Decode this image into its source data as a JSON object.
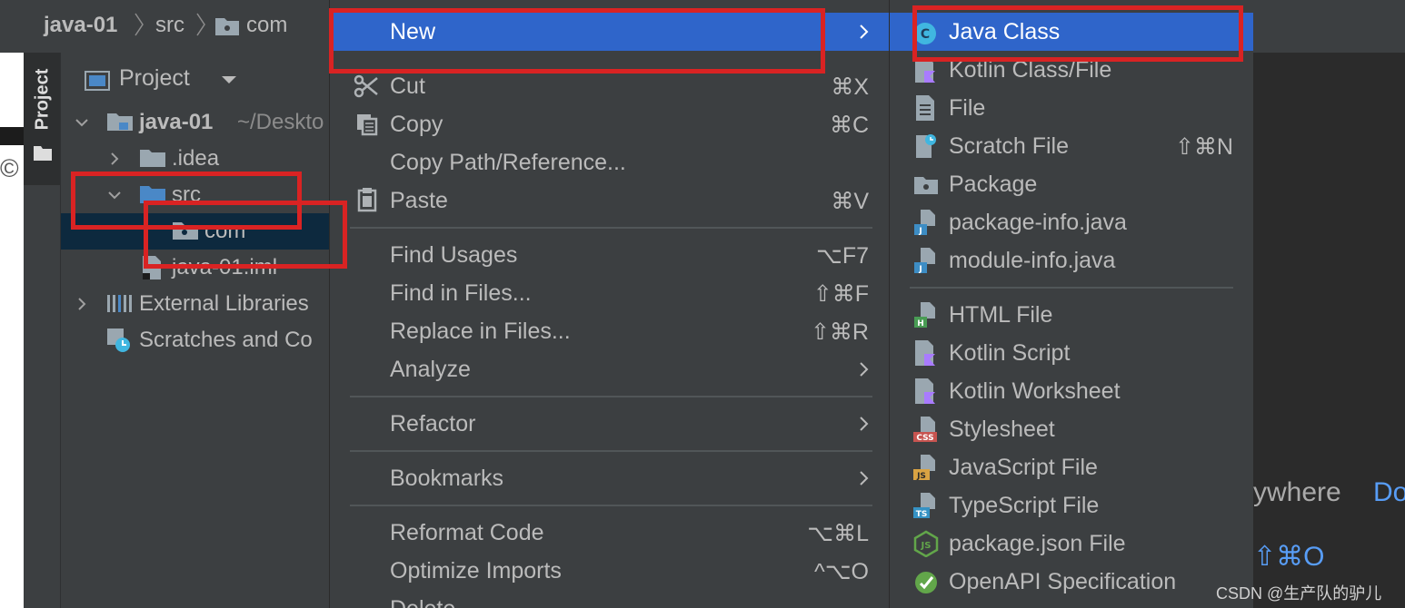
{
  "breadcrumb": {
    "project": "java-01",
    "src": "src",
    "com": "com"
  },
  "toolwindow": {
    "tab_label": "Project"
  },
  "project_panel": {
    "header": "Project",
    "tree": [
      {
        "label": "java-01",
        "hint": "~/Deskto"
      },
      {
        "label": ".idea"
      },
      {
        "label": "src"
      },
      {
        "label": "com"
      },
      {
        "label": "java-01.iml"
      },
      {
        "label": "External Libraries"
      },
      {
        "label": "Scratches and Co"
      }
    ]
  },
  "context_menu": {
    "items": [
      {
        "label": "New",
        "shortcut": ""
      },
      {
        "label": "Cut",
        "shortcut": "⌘X"
      },
      {
        "label": "Copy",
        "shortcut": "⌘C"
      },
      {
        "label": "Copy Path/Reference...",
        "shortcut": ""
      },
      {
        "label": "Paste",
        "shortcut": "⌘V"
      },
      {
        "label": "Find Usages",
        "shortcut": "⌥F7"
      },
      {
        "label": "Find in Files...",
        "shortcut": "⇧⌘F"
      },
      {
        "label": "Replace in Files...",
        "shortcut": "⇧⌘R"
      },
      {
        "label": "Analyze",
        "shortcut": ""
      },
      {
        "label": "Refactor",
        "shortcut": ""
      },
      {
        "label": "Bookmarks",
        "shortcut": ""
      },
      {
        "label": "Reformat Code",
        "shortcut": "⌥⌘L"
      },
      {
        "label": "Optimize Imports",
        "shortcut": "^⌥O"
      },
      {
        "label": "Delete",
        "shortcut": ""
      }
    ]
  },
  "new_submenu": {
    "items": [
      {
        "label": "Java Class",
        "shortcut": "",
        "badge": "C"
      },
      {
        "label": "Kotlin Class/File",
        "shortcut": "",
        "badge": "K"
      },
      {
        "label": "File",
        "shortcut": "",
        "badge": ""
      },
      {
        "label": "Scratch File",
        "shortcut": "⇧⌘N",
        "badge": ""
      },
      {
        "label": "Package",
        "shortcut": "",
        "badge": ""
      },
      {
        "label": "package-info.java",
        "shortcut": "",
        "badge": "J"
      },
      {
        "label": "module-info.java",
        "shortcut": "",
        "badge": "J"
      },
      {
        "label": "HTML File",
        "shortcut": "",
        "badge": "H"
      },
      {
        "label": "Kotlin Script",
        "shortcut": "",
        "badge": "K"
      },
      {
        "label": "Kotlin Worksheet",
        "shortcut": "",
        "badge": "K"
      },
      {
        "label": "Stylesheet",
        "shortcut": "",
        "badge": "CSS"
      },
      {
        "label": "JavaScript File",
        "shortcut": "",
        "badge": "JS"
      },
      {
        "label": "TypeScript File",
        "shortcut": "",
        "badge": "TS"
      },
      {
        "label": "package.json File",
        "shortcut": "",
        "badge": "JS"
      },
      {
        "label": "OpenAPI Specification",
        "shortcut": "",
        "badge": ""
      }
    ]
  },
  "editor_hint": {
    "text1": "ywhere",
    "text2": "Do",
    "shortcut": "⇧⌘O"
  },
  "watermark": "CSDN @生产队的驴儿",
  "colors": {
    "selection": "#2f65ca",
    "highlight_box": "#d92323",
    "link": "#589df6"
  }
}
